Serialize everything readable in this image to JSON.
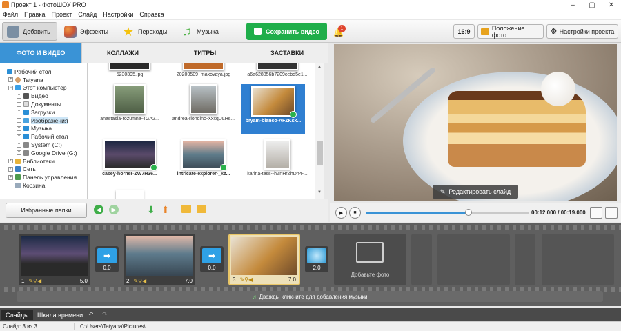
{
  "window": {
    "title": "Проект 1 - ФотоШОУ PRO"
  },
  "menu": [
    "Файл",
    "Правка",
    "Проект",
    "Слайд",
    "Настройки",
    "Справка"
  ],
  "toolbar": {
    "tabs": [
      "Добавить",
      "Эффекты",
      "Переходы",
      "Музыка"
    ],
    "save": "Сохранить видео",
    "notif": "1",
    "ratio": "16:9",
    "photo_pos": "Положение фото",
    "settings": "Настройки проекта"
  },
  "left_tabs": [
    "ФОТО И ВИДЕО",
    "КОЛЛАЖИ",
    "ТИТРЫ",
    "ЗАСТАВКИ"
  ],
  "tree": [
    "Рабочий стол",
    "Tatyana",
    "Этот компьютер",
    "Видео",
    "Документы",
    "Загрузки",
    "Изображения",
    "Музыка",
    "Рабочий стол",
    "System (C:)",
    "Google Drive (G:)",
    "Библиотеки",
    "Сеть",
    "Панель управления",
    "Корзина"
  ],
  "files": [
    "5230395.jpg",
    "20200509_maxovaya.jpg",
    "a6a628856b7209cebd5e1...",
    "anastasia-rozumna-4GA2...",
    "andrea-riondino-XxxqULHs...",
    "bryam-blanco-AFZKsx...",
    "casey-horner-ZW7H36...",
    "intricate-explorer-_xz...",
    "karina-tess--hZnHrZhDn4-..."
  ],
  "fav": "Избранные папки",
  "preview": {
    "edit": "Редактировать слайд",
    "time": "00:12.000 / 00:19.000",
    "progress": 0.63
  },
  "slides": [
    {
      "n": "1",
      "dur": "5.0"
    },
    {
      "n": "2",
      "dur": "7.0"
    },
    {
      "n": "3",
      "dur": "7.0"
    }
  ],
  "transitions": [
    "0.0",
    "0.0",
    "2.0"
  ],
  "add_photo": "Добавьте фото",
  "music_hint": "Дважды кликните для добавления музыки",
  "bottom_tabs": [
    "Слайды",
    "Шкала времени"
  ],
  "status": {
    "slides": "Слайд: 3 из 3",
    "path": "C:\\Users\\Tatyana\\Pictures\\"
  }
}
